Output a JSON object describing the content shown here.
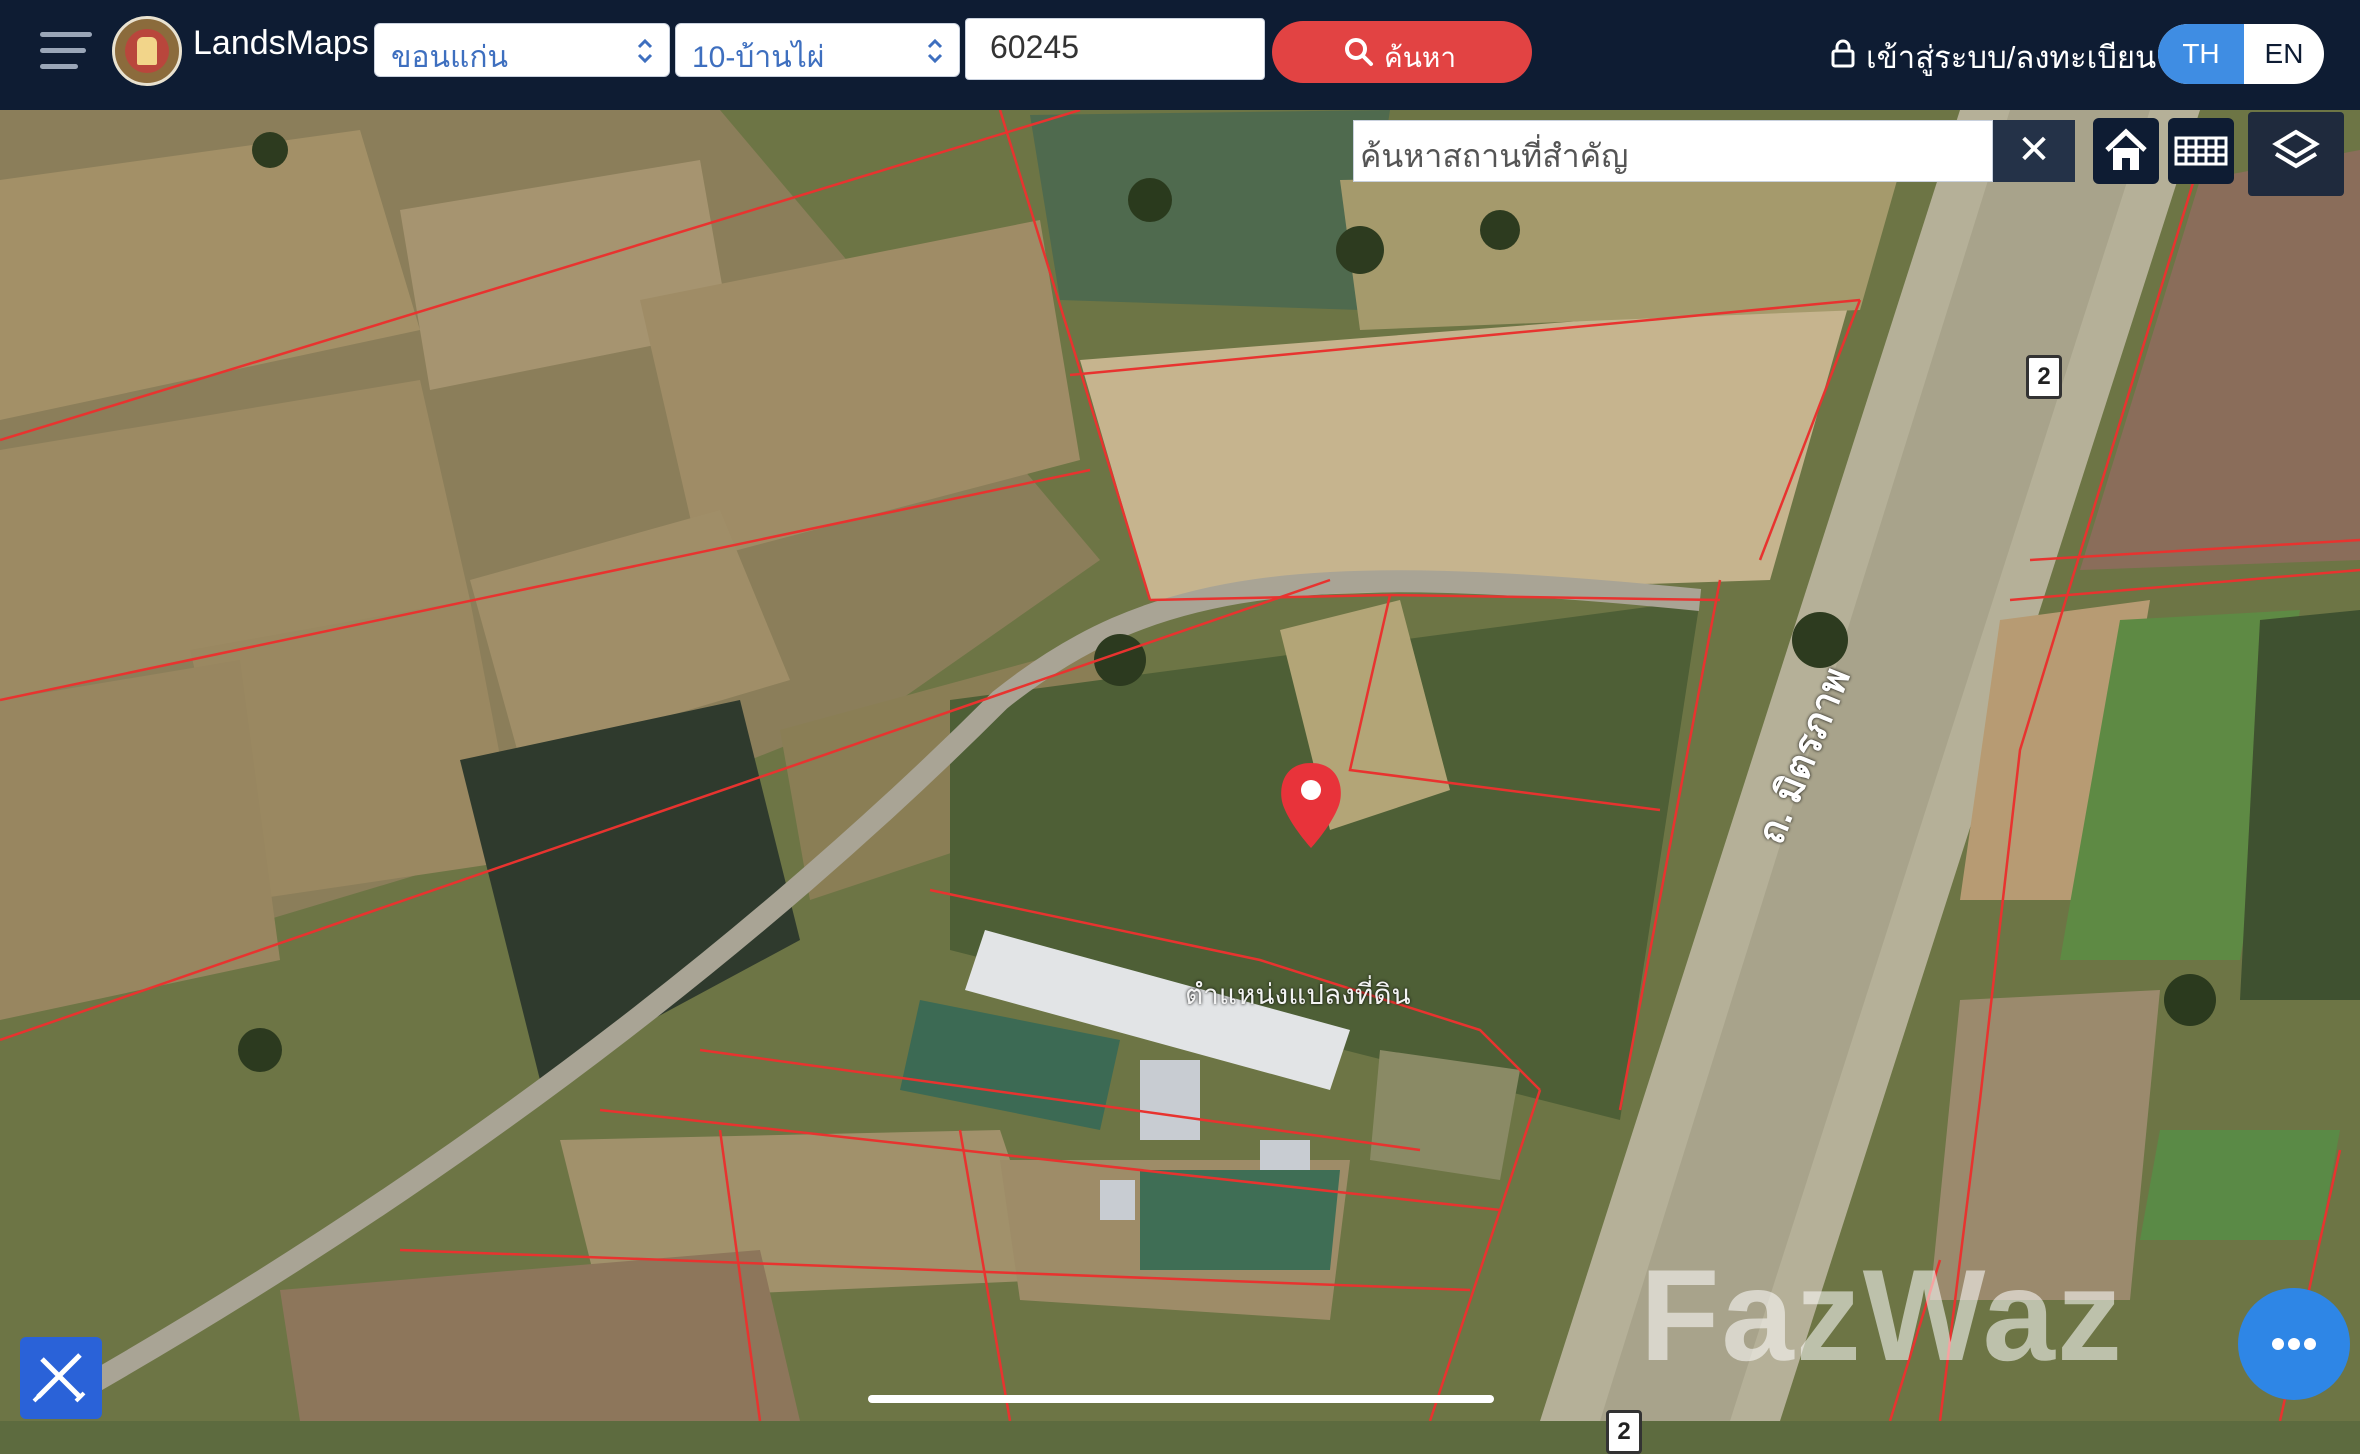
{
  "app": {
    "brand": "LandsMaps",
    "logo_icon": "land-department-seal-icon"
  },
  "search": {
    "province": "ขอนแก่น",
    "amphur": "10-บ้านไผ่",
    "parcel_number": "60245",
    "button_label": "ค้นหา"
  },
  "account": {
    "login_label": "เข้าสู่ระบบ/ลงทะเบียน"
  },
  "language": {
    "options": [
      "TH",
      "EN"
    ],
    "selected": "TH"
  },
  "map": {
    "place_search_placeholder": "ค้นหาสถานที่สำคัญ",
    "clear_label": "✕",
    "pin_label": "ตำแหน่งแปลงที่ดิน",
    "road_label": "ถ. มิตรภาพ",
    "highway_number": "2",
    "watermark": "FazWaz",
    "more_label": "•••",
    "parcel_boundary_color": "#e8332f",
    "pin_color": "#e8333a"
  }
}
